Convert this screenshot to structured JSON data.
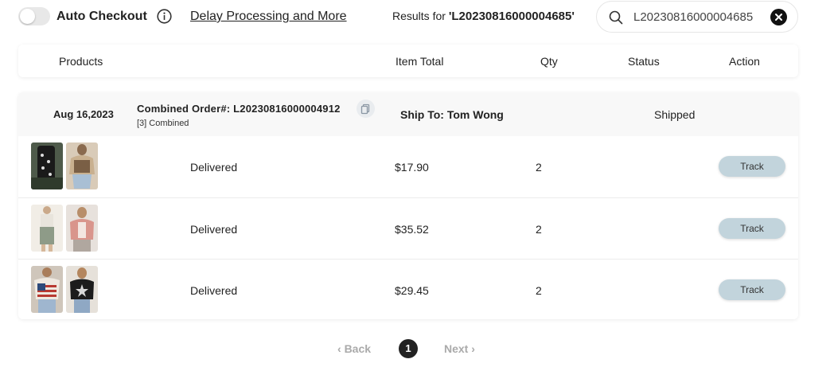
{
  "topbar": {
    "auto_checkout_label": "Auto Checkout",
    "auto_checkout_enabled": false,
    "delay_link": "Delay Processing and More",
    "results_prefix": "Results for ",
    "results_query": "'L20230816000004685'",
    "search_value": "L20230816000004685",
    "icons": {
      "info": "info-icon",
      "search": "search-icon",
      "clear": "close-icon"
    }
  },
  "table_header": {
    "products": "Products",
    "item_total": "Item Total",
    "qty": "Qty",
    "status": "Status",
    "action": "Action"
  },
  "order": {
    "date": "Aug 16,2023",
    "combined_order_label": "Combined Order#: L20230816000004912",
    "combined_count": "[3] Combined",
    "ship_to": "Ship To: Tom Wong",
    "status": "Shipped",
    "items": [
      {
        "status": "Delivered",
        "total": "$17.90",
        "qty": "2",
        "action": "Track"
      },
      {
        "status": "Delivered",
        "total": "$35.52",
        "qty": "2",
        "action": "Track"
      },
      {
        "status": "Delivered",
        "total": "$29.45",
        "qty": "2",
        "action": "Track"
      }
    ]
  },
  "pagination": {
    "back": "Back",
    "current": "1",
    "next": "Next"
  },
  "colors": {
    "track_button": "#c2d4dc",
    "pager_active": "#222222",
    "pager_disabled": "#aaaaaa"
  }
}
